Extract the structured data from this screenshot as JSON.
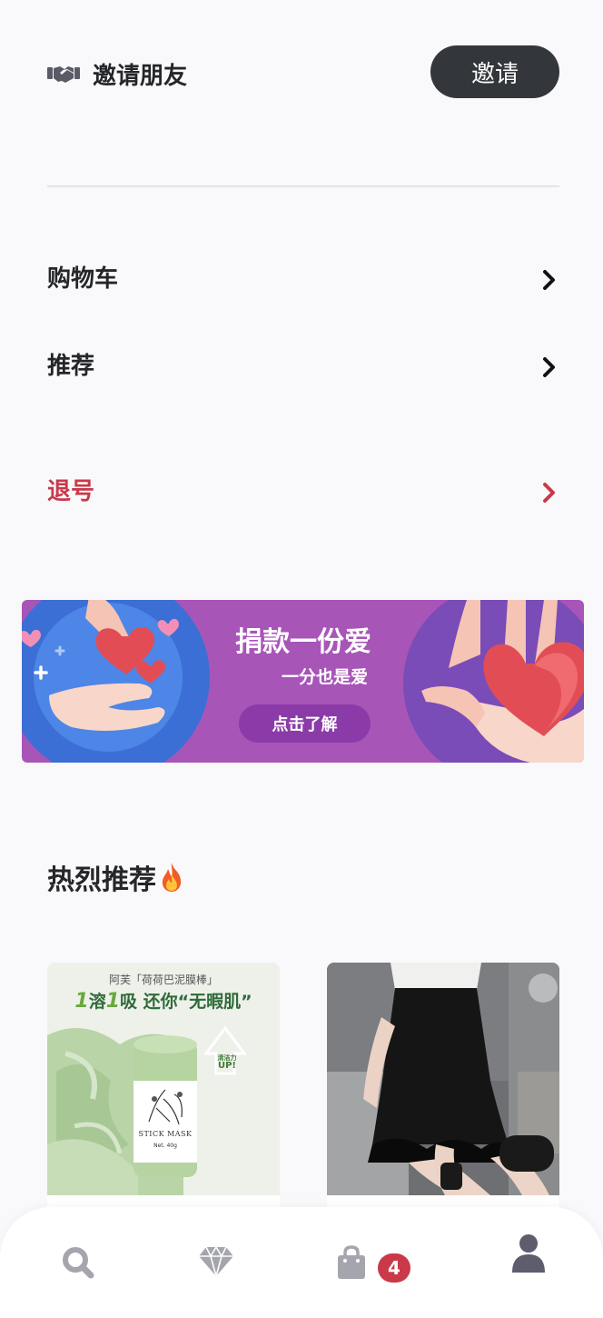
{
  "invite": {
    "label": "邀请朋友",
    "button_label": "邀请"
  },
  "menu": [
    {
      "label": "购物车"
    },
    {
      "label": "推荐"
    },
    {
      "label": "退号"
    }
  ],
  "banner": {
    "title": "捐款一份爱",
    "subtitle": "一分也是爱",
    "cta": "点击了解",
    "colors": {
      "background": "#a855b8",
      "button": "#8b3ba8",
      "circle": "#3b6fd6"
    }
  },
  "section": {
    "title": "热烈推荐"
  },
  "products": [
    {
      "brand": "阿芙「荷荷巴泥膜棒」",
      "slogan_pre": "1",
      "slogan_mid": "溶",
      "slogan_pre2": "1",
      "slogan_post": "吸 还你“无暇肌”",
      "jar_text": "STICK MASK",
      "jar_net": "Net. 40g",
      "up_small": "清洁力",
      "up_big": "UP!",
      "weight": "40g"
    },
    {
      "image": "black-ruffle-skirt-photo"
    }
  ],
  "tabbar": {
    "items": [
      {
        "icon": "search-icon"
      },
      {
        "icon": "diamond-icon"
      },
      {
        "icon": "shopping-bag-icon",
        "badge": "4"
      },
      {
        "icon": "user-icon",
        "active": true
      }
    ],
    "colors": {
      "inactive": "#a5a5ad",
      "active": "#5d5d6e",
      "badge": "#c9394a"
    }
  }
}
